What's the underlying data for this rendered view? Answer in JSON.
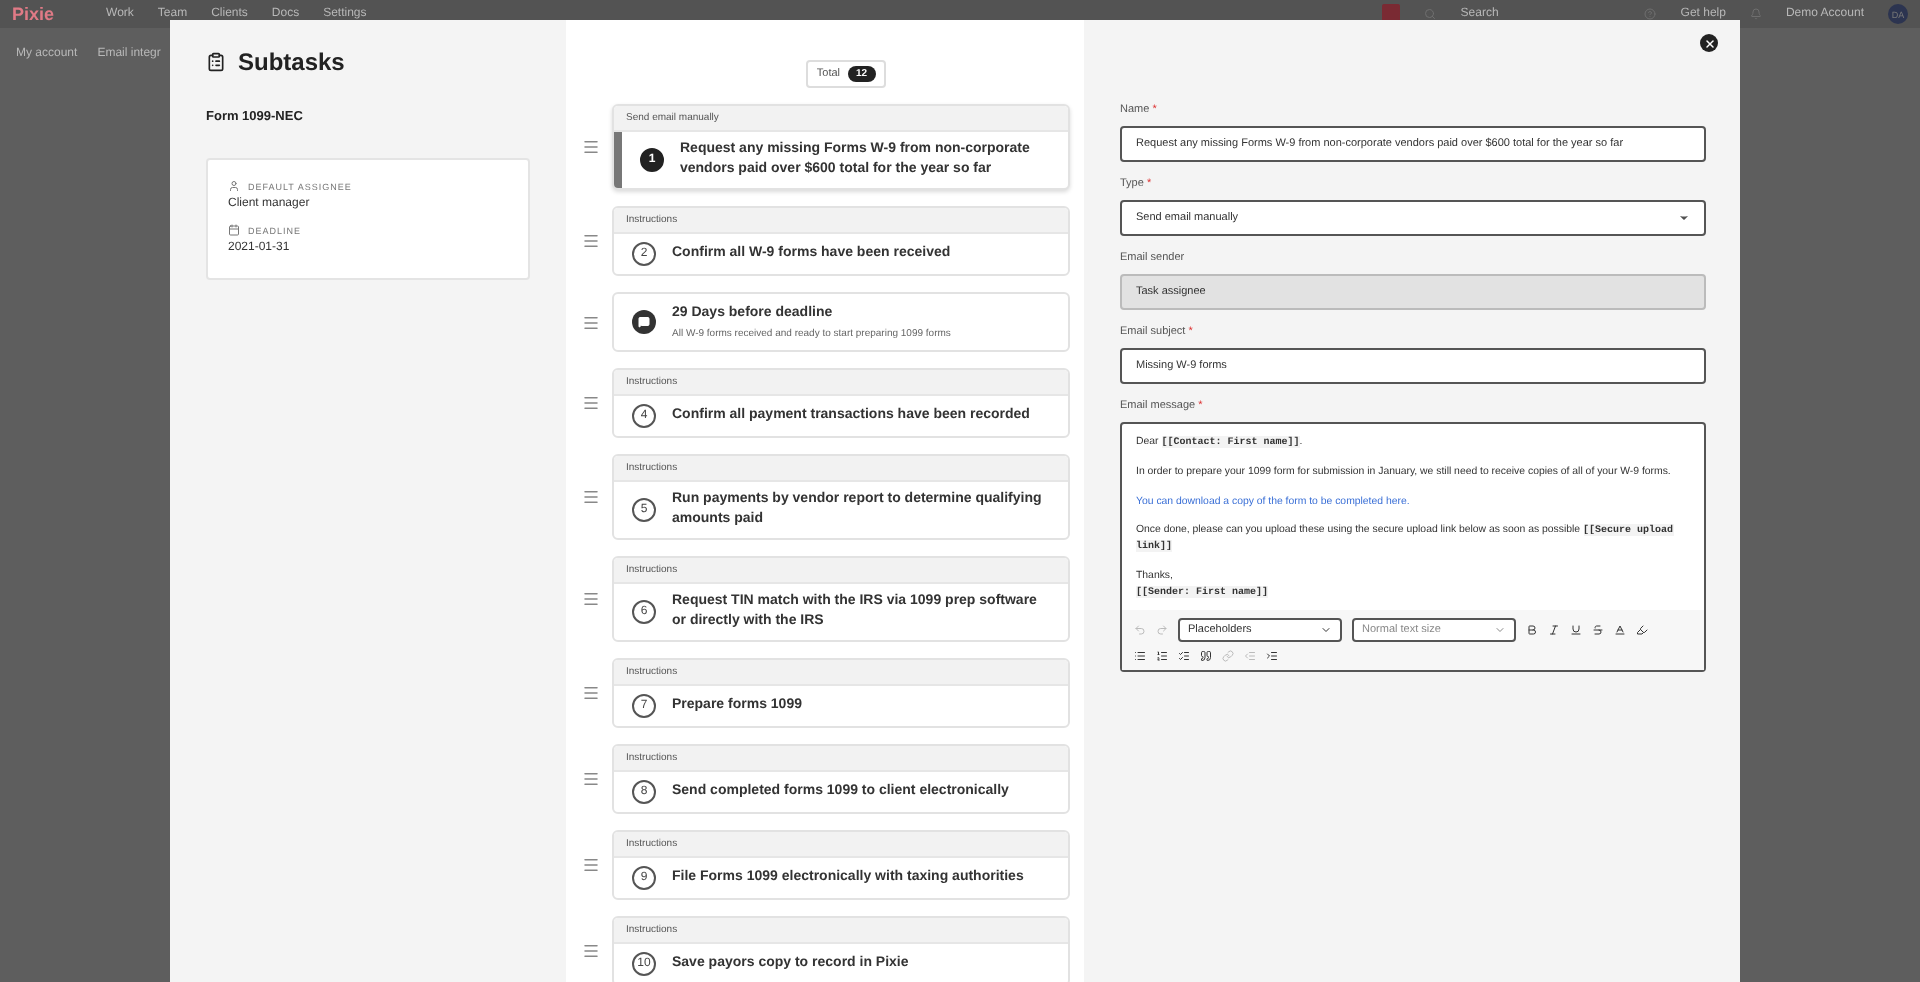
{
  "app_bar": {
    "logo": "Pixie",
    "nav": [
      "Work",
      "Team",
      "Clients",
      "Docs",
      "Settings"
    ],
    "search": "Search",
    "help": "Get help",
    "account": "Demo Account",
    "avatar": "DA"
  },
  "sub_nav": [
    "My account",
    "Email integr"
  ],
  "sidebar": {
    "title": "Subtasks",
    "form_name": "Form 1099-NEC",
    "assignee_label": "DEFAULT ASSIGNEE",
    "assignee": "Client manager",
    "deadline_label": "DEADLINE",
    "deadline": "2021-01-31"
  },
  "total": {
    "label": "Total",
    "count": "12"
  },
  "tasks": [
    {
      "kind": "task",
      "type": "Send email manually",
      "number": "1",
      "title": "Request any missing Forms W-9 from non-corporate vendors paid over $600 total for the year so far",
      "selected": true
    },
    {
      "kind": "task",
      "type": "Instructions",
      "number": "2",
      "title": "Confirm all W-9 forms have been received",
      "selected": false
    },
    {
      "kind": "milestone",
      "title": "29 Days before deadline",
      "note": "All W-9 forms received and ready to start preparing 1099 forms",
      "selected": false
    },
    {
      "kind": "task",
      "type": "Instructions",
      "number": "4",
      "title": "Confirm all payment transactions have been recorded",
      "selected": false
    },
    {
      "kind": "task",
      "type": "Instructions",
      "number": "5",
      "title": "Run payments by vendor report to determine qualifying amounts paid",
      "selected": false
    },
    {
      "kind": "task",
      "type": "Instructions",
      "number": "6",
      "title": "Request TIN match with the IRS via 1099 prep software or directly with the IRS",
      "selected": false
    },
    {
      "kind": "task",
      "type": "Instructions",
      "number": "7",
      "title": "Prepare forms 1099",
      "selected": false
    },
    {
      "kind": "task",
      "type": "Instructions",
      "number": "8",
      "title": "Send completed forms 1099 to client electronically",
      "selected": false
    },
    {
      "kind": "task",
      "type": "Instructions",
      "number": "9",
      "title": "File Forms 1099 electronically with taxing authorities",
      "selected": false
    },
    {
      "kind": "task",
      "type": "Instructions",
      "number": "10",
      "title": "Save payors copy to record in Pixie",
      "selected": false
    }
  ],
  "form": {
    "fields": [
      {
        "kind": "text",
        "label": "Name",
        "required_mark": "*",
        "value": "Request any missing Forms W-9 from non-corporate vendors paid over $600 total for the year so far"
      },
      {
        "kind": "select",
        "label": "Type",
        "required_mark": "*",
        "value": "Send email manually"
      },
      {
        "kind": "text",
        "label": "Email sender",
        "value": "Task assignee",
        "disabled": true
      },
      {
        "kind": "text",
        "label": "Email subject",
        "required_mark": "*",
        "value": "Missing W-9 forms"
      }
    ],
    "message": {
      "label": "Email message",
      "required_mark": "*",
      "paragraphs": [
        [
          {
            "kind": "text",
            "text": "Dear "
          },
          {
            "kind": "placeholder",
            "text": "[[Contact: First name]]"
          },
          {
            "kind": "text",
            "text": "."
          }
        ],
        [
          {
            "kind": "text",
            "text": "In order to prepare your 1099 form for submission in January, we still need to receive copies of all of your W-9 forms."
          }
        ],
        [
          {
            "kind": "link",
            "text": "You can download a copy of the form to be completed here."
          }
        ],
        [
          {
            "kind": "text",
            "text": "Once done, please can you upload these using the secure upload link below as soon as possible "
          },
          {
            "kind": "placeholder",
            "text": "[[Secure upload link]]"
          }
        ],
        [
          {
            "kind": "text",
            "text": "Thanks,"
          },
          {
            "kind": "break"
          },
          {
            "kind": "placeholder",
            "text": "[[Sender: First name]]"
          }
        ]
      ],
      "placeholders": "Placeholders",
      "text_size": "Normal text size"
    }
  }
}
